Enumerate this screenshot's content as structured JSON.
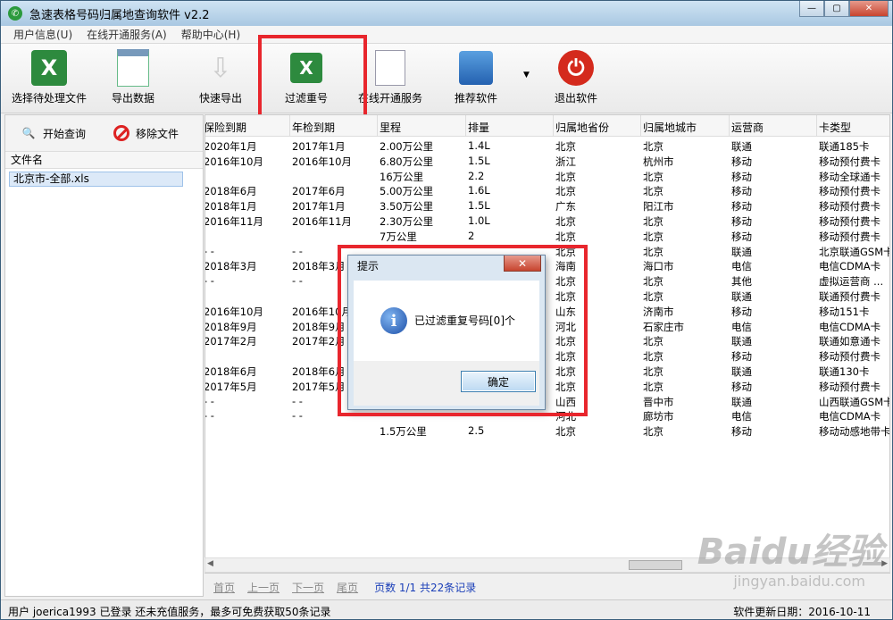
{
  "window": {
    "title": "急速表格号码归属地查询软件 v2.2",
    "controls": [
      "—",
      "▢",
      "✕"
    ]
  },
  "menu": [
    "用户信息(U)",
    "在线开通服务(A)",
    "帮助中心(H)"
  ],
  "toolbar": {
    "select_file": "选择待处理文件",
    "export_data": "导出数据",
    "quick_export": "快速导出",
    "filter_dup": "过滤重号",
    "online_service": "在线开通服务",
    "recommend": "推荐软件",
    "exit": "退出软件"
  },
  "left_panel": {
    "start_query": "开始查询",
    "remove_file": "移除文件",
    "file_header": "文件名",
    "files": [
      "北京市-全部.xls"
    ]
  },
  "table": {
    "headers": [
      "保险到期",
      "年检到期",
      "里程",
      "排量",
      "归属地省份",
      "归属地城市",
      "运营商",
      "卡类型"
    ],
    "rows": [
      [
        "2020年1月",
        "2017年1月",
        "2.00万公里",
        "1.4L",
        "北京",
        "北京",
        "联通",
        "联通185卡"
      ],
      [
        "2016年10月",
        "2016年10月",
        "6.80万公里",
        "1.5L",
        "浙江",
        "杭州市",
        "移动",
        "移动预付费卡"
      ],
      [
        "",
        "",
        "16万公里",
        "2.2",
        "北京",
        "北京",
        "移动",
        "移动全球通卡"
      ],
      [
        "2018年6月",
        "2017年6月",
        "5.00万公里",
        "1.6L",
        "北京",
        "北京",
        "移动",
        "移动预付费卡"
      ],
      [
        "2018年1月",
        "2017年1月",
        "3.50万公里",
        "1.5L",
        "广东",
        "阳江市",
        "移动",
        "移动预付费卡"
      ],
      [
        "2016年11月",
        "2016年11月",
        "2.30万公里",
        "1.0L",
        "北京",
        "北京",
        "移动",
        "移动预付费卡"
      ],
      [
        "",
        "",
        "7万公里",
        "2",
        "北京",
        "北京",
        "移动",
        "移动预付费卡"
      ],
      [
        "- -",
        "- -",
        "",
        "",
        "北京",
        "北京",
        "联通",
        "北京联通GSM卡"
      ],
      [
        "2018年3月",
        "2018年3月",
        "",
        "",
        "海南",
        "海口市",
        "电信",
        "电信CDMA卡"
      ],
      [
        "- -",
        "- -",
        "",
        "",
        "北京",
        "北京",
        "其他",
        "虚拟运营商 ..."
      ],
      [
        "",
        "",
        "",
        "",
        "北京",
        "北京",
        "联通",
        "联通预付费卡"
      ],
      [
        "2016年10月",
        "2016年10月",
        "",
        "",
        "山东",
        "济南市",
        "移动",
        "移动151卡"
      ],
      [
        "2018年9月",
        "2018年9月",
        "",
        "",
        "河北",
        "石家庄市",
        "电信",
        "电信CDMA卡"
      ],
      [
        "2017年2月",
        "2017年2月",
        "",
        "",
        "北京",
        "北京",
        "联通",
        "联通如意通卡"
      ],
      [
        "",
        "",
        "",
        "",
        "北京",
        "北京",
        "移动",
        "移动预付费卡"
      ],
      [
        "2018年6月",
        "2018年6月",
        "",
        "",
        "北京",
        "北京",
        "联通",
        "联通130卡"
      ],
      [
        "2017年5月",
        "2017年5月",
        "",
        "",
        "北京",
        "北京",
        "移动",
        "移动预付费卡"
      ],
      [
        "- -",
        "- -",
        "",
        "",
        "山西",
        "晋中市",
        "联通",
        "山西联通GSM卡"
      ],
      [
        "- -",
        "- -",
        "",
        "",
        "河北",
        "廊坊市",
        "电信",
        "电信CDMA卡"
      ],
      [
        "",
        "",
        "1.5万公里",
        "2.5",
        "北京",
        "北京",
        "移动",
        "移动动感地带卡"
      ]
    ]
  },
  "pager": {
    "first": "首页",
    "prev": "上一页",
    "next": "下一页",
    "last": "尾页",
    "info": "页数 1/1 共22条记录"
  },
  "status": {
    "left": "用户 joerica1993 已登录 还未充值服务，最多可免费获取50条记录",
    "right": "软件更新日期：2016-10-11"
  },
  "dialog": {
    "title": "提示",
    "message": "已过滤重复号码[0]个",
    "ok": "确定",
    "close": "✕"
  },
  "watermark": {
    "main": "Baidu经验",
    "sub": "jingyan.baidu.com"
  },
  "colors": {
    "highlight": "#e8262d",
    "link": "#1b3fb8"
  }
}
